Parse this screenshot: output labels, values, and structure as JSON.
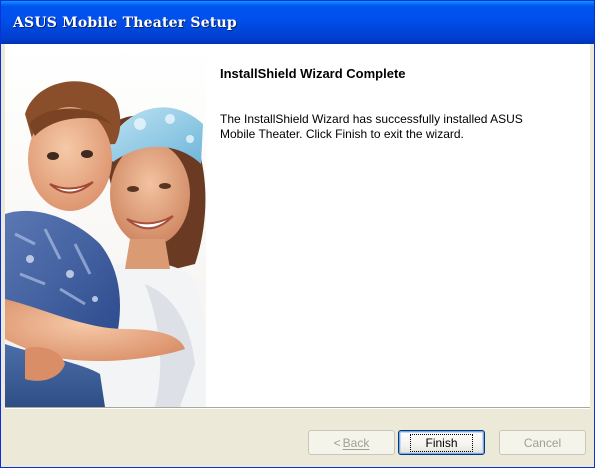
{
  "window": {
    "title": "ASUS Mobile Theater Setup"
  },
  "main": {
    "heading": "InstallShield Wizard Complete",
    "message": "The InstallShield Wizard has successfully installed ASUS Mobile Theater.  Click Finish to exit the wizard."
  },
  "buttons": {
    "back_chevron": "<",
    "back_label": "Back",
    "finish_label": "Finish",
    "cancel_label": "Cancel"
  },
  "colors": {
    "title_bar": "#0053EE",
    "dialog_bg": "#ECE9D8"
  }
}
